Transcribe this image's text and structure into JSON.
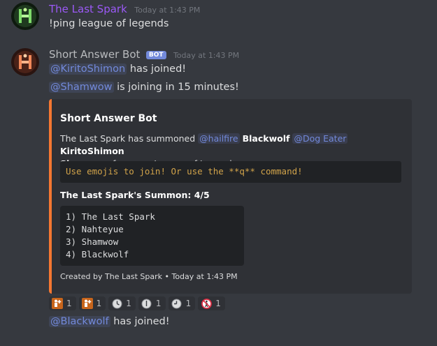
{
  "messages": [
    {
      "author": "The Last Spark",
      "timestamp": "Today at 1:43 PM",
      "text": "!ping league of legends"
    },
    {
      "author": "Short Answer Bot",
      "bot_tag": "BOT",
      "timestamp": "Today at 1:43 PM",
      "line1_mention": "@KiritoShimon",
      "line1_text": "has joined!",
      "line2_mention": "@Shamwow",
      "line2_text": "is joining in 15 minutes!"
    }
  ],
  "embed": {
    "accent_color": "#f57731",
    "title": "Short Answer Bot",
    "desc_part1": "The Last Spark has summoned",
    "mention_hailfire": "@hailfire",
    "bold_blackwolf": "Blackwolf",
    "mention_dogeater": "@Dog Eater",
    "bold_kirito": "KiritoShimon",
    "bold_shamwow": "Shamwow",
    "desc_part2": "for some League of Legends",
    "code_inline": "Use emojis to join! Or use the **q** command!",
    "field_title": "The Last Spark's Summon: 4/5",
    "code_lines": [
      "1) The Last Spark",
      "2) Nahteyue",
      "3) Shamwow",
      "4) Blackwolf"
    ],
    "footer": "Created by The Last Spark • Today at 1:43 PM"
  },
  "reactions": [
    {
      "icon": "person-plus-icon",
      "count": "1",
      "color": "#c8651b"
    },
    {
      "icon": "person-plus-icon",
      "count": "1",
      "color": "#c8651b"
    },
    {
      "icon": "clock-icon",
      "count": "1",
      "color": "#dcddde"
    },
    {
      "icon": "clock-icon",
      "count": "1",
      "color": "#dcddde"
    },
    {
      "icon": "clock-icon",
      "count": "1",
      "color": "#dcddde"
    },
    {
      "icon": "no-pedestrians-icon",
      "count": "1",
      "color": "#dd2e44"
    }
  ],
  "last_message": {
    "mention": "@Blackwolf",
    "text": "has joined!"
  }
}
